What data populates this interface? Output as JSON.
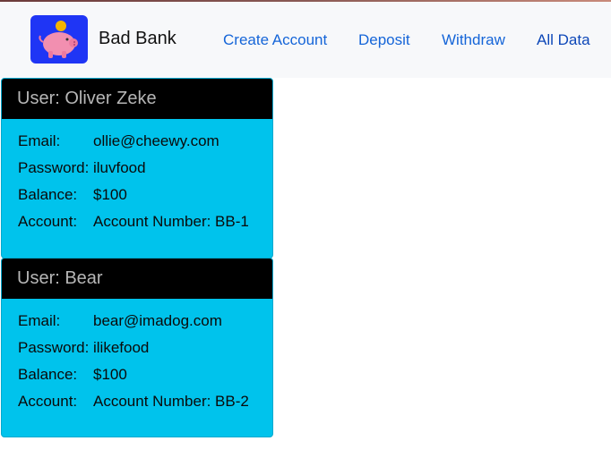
{
  "brand": {
    "name": "Bad Bank",
    "logo_icon": "piggy-bank-icon"
  },
  "nav": {
    "links": [
      {
        "label": "Create Account"
      },
      {
        "label": "Deposit"
      },
      {
        "label": "Withdraw"
      },
      {
        "label": "All Data"
      }
    ]
  },
  "labels": {
    "email": "Email:",
    "password": "Password:",
    "balance": "Balance:",
    "account": "Account:"
  },
  "users": [
    {
      "header": "User: Oliver Zeke",
      "email": "ollie@cheewy.com",
      "password": "iluvfood",
      "balance": "$100",
      "account": "Account Number: BB-1"
    },
    {
      "header": "User: Bear",
      "email": "bear@imadog.com",
      "password": "ilikefood",
      "balance": "$100",
      "account": "Account Number: BB-2"
    }
  ],
  "colors": {
    "card_bg": "#00c3ec",
    "card_header_bg": "#000000",
    "link": "#1565d8",
    "logo_bg": "#1f35f5"
  }
}
